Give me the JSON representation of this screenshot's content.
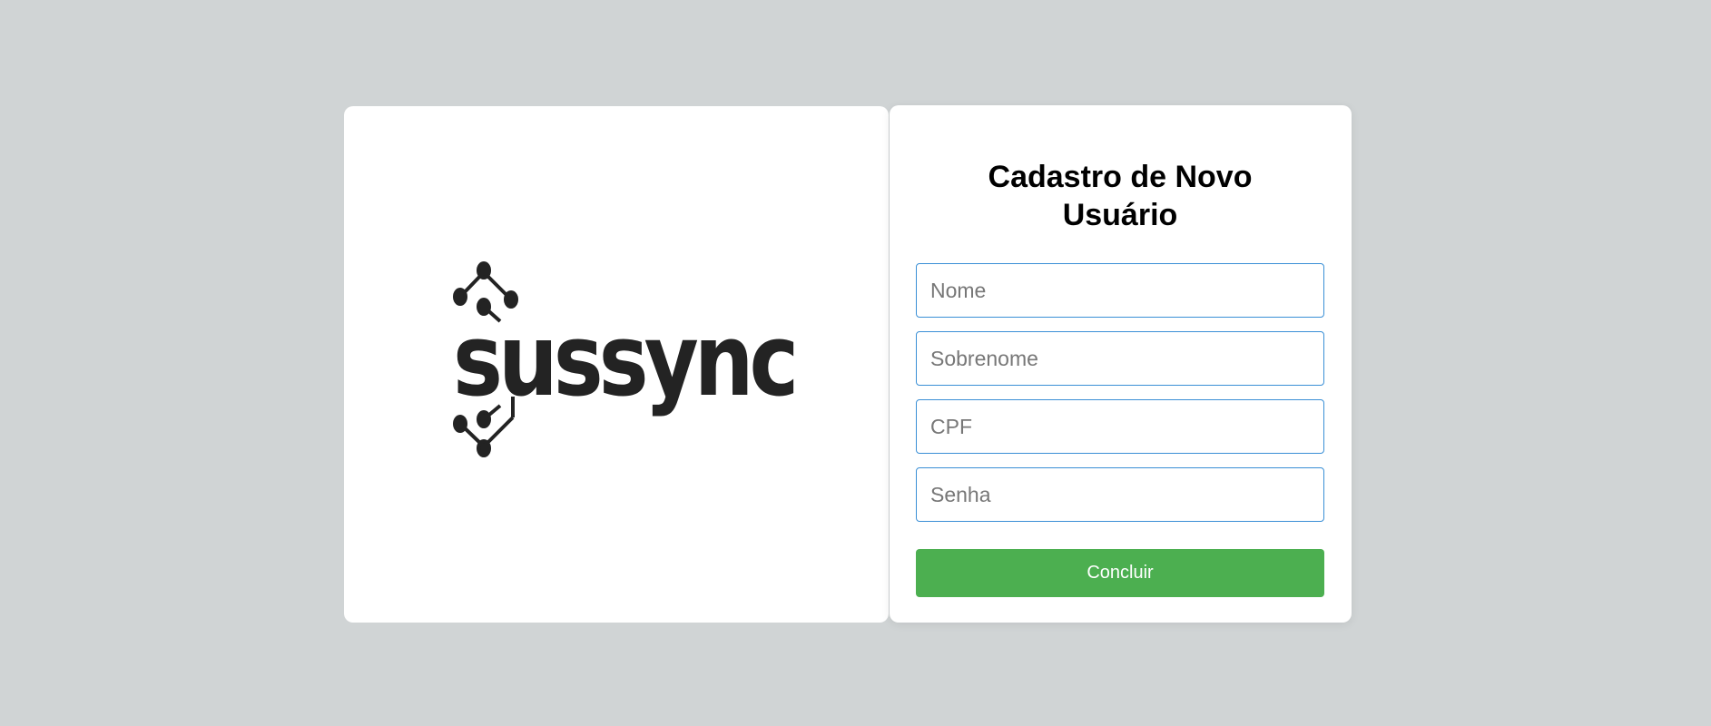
{
  "logo": {
    "text": "SUSSync",
    "display_text": "sussync"
  },
  "form": {
    "title": "Cadastro de Novo Usuário",
    "fields": [
      {
        "placeholder": "Nome",
        "value": ""
      },
      {
        "placeholder": "Sobrenome",
        "value": ""
      },
      {
        "placeholder": "CPF",
        "value": ""
      },
      {
        "placeholder": "Senha",
        "value": ""
      }
    ],
    "submit_label": "Concluir"
  },
  "colors": {
    "background": "#d0d4d5",
    "panel": "#ffffff",
    "input_border": "#3a8fd6",
    "button": "#4caf50",
    "logo": "#232323"
  }
}
